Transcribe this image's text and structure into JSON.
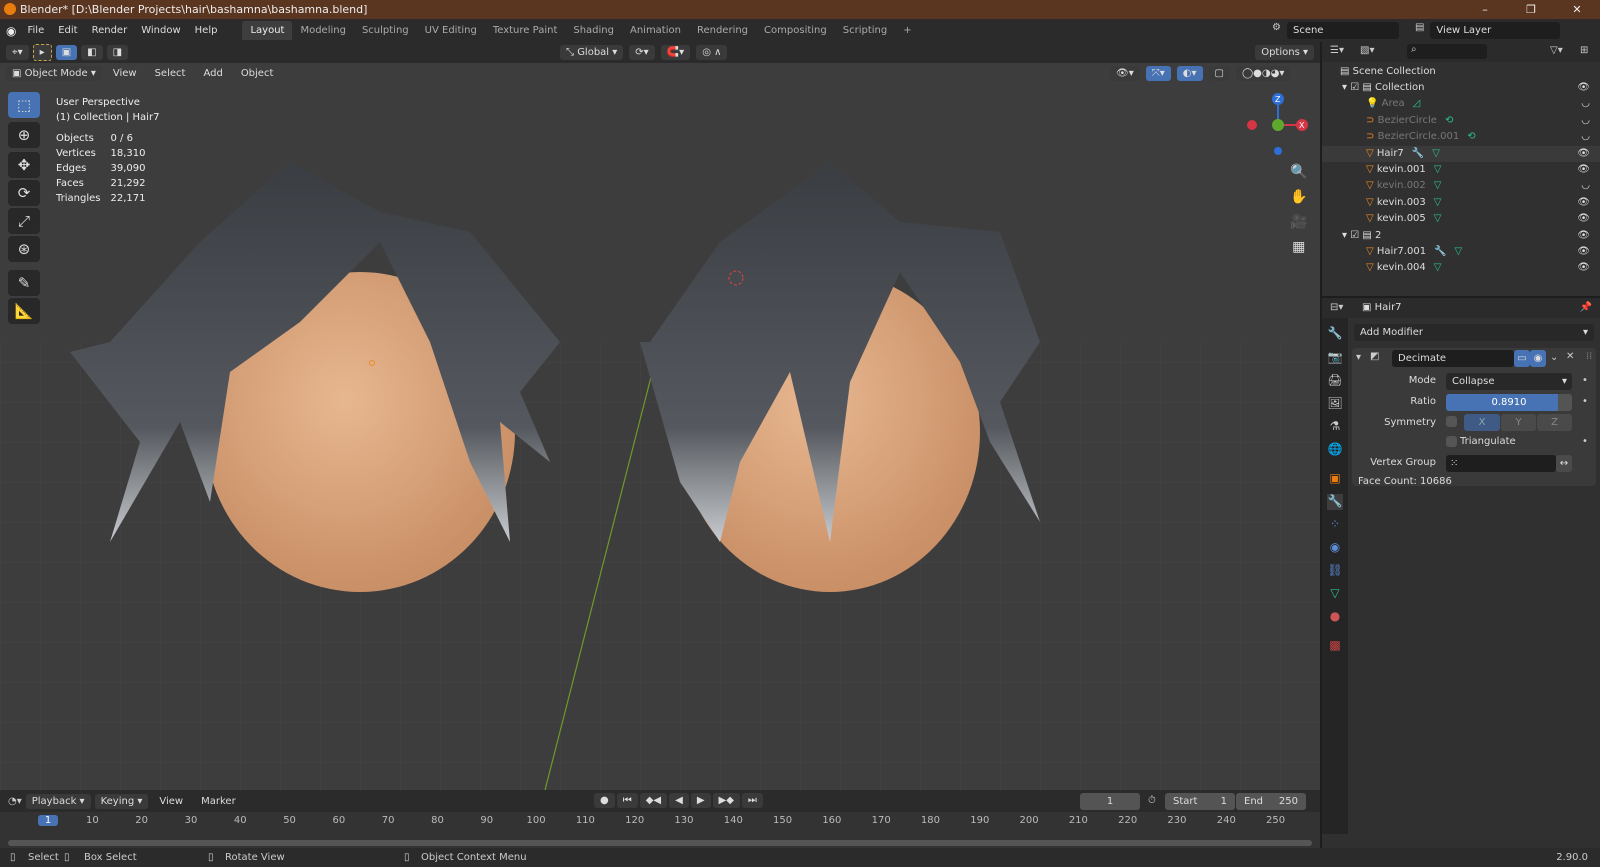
{
  "title": "Blender* [D:\\Blender Projects\\hair\\bashamna\\bashamna.blend]",
  "window_buttons": [
    "–",
    "❐",
    "✕"
  ],
  "menus": [
    "File",
    "Edit",
    "Render",
    "Window",
    "Help"
  ],
  "workspaces": [
    "Layout",
    "Modeling",
    "Sculpting",
    "UV Editing",
    "Texture Paint",
    "Shading",
    "Animation",
    "Rendering",
    "Compositing",
    "Scripting",
    "+"
  ],
  "scene": "Scene",
  "view_layer": "View Layer",
  "viewport": {
    "orientation": "Global",
    "options": "Options",
    "mode": "Object Mode",
    "menus": [
      "View",
      "Select",
      "Add",
      "Object"
    ],
    "perspective": "User Perspective",
    "collection": "(1) Collection | Hair7",
    "stats": [
      [
        "Objects",
        "0 / 6"
      ],
      [
        "Vertices",
        "18,310"
      ],
      [
        "Edges",
        "39,090"
      ],
      [
        "Faces",
        "21,292"
      ],
      [
        "Triangles",
        "22,171"
      ]
    ],
    "gizmo": {
      "x": "X",
      "z": "Z"
    }
  },
  "outliner": {
    "root": "Scene Collection",
    "items": [
      {
        "name": "Collection",
        "level": 0,
        "type": "collection",
        "dim": false
      },
      {
        "name": "Area",
        "level": 1,
        "type": "light",
        "dim": true
      },
      {
        "name": "BezierCircle",
        "level": 1,
        "type": "curve",
        "dim": true
      },
      {
        "name": "BezierCircle.001",
        "level": 1,
        "type": "curve",
        "dim": true
      },
      {
        "name": "Hair7",
        "level": 1,
        "type": "mesh",
        "dim": false,
        "modifier": true
      },
      {
        "name": "kevin.001",
        "level": 1,
        "type": "mesh",
        "dim": false
      },
      {
        "name": "kevin.002",
        "level": 1,
        "type": "mesh",
        "dim": true
      },
      {
        "name": "kevin.003",
        "level": 1,
        "type": "mesh",
        "dim": false
      },
      {
        "name": "kevin.005",
        "level": 1,
        "type": "mesh",
        "dim": false
      },
      {
        "name": "2",
        "level": 0,
        "type": "collection",
        "dim": false
      },
      {
        "name": "Hair7.001",
        "level": 1,
        "type": "mesh",
        "dim": false,
        "modifier": true
      },
      {
        "name": "kevin.004",
        "level": 1,
        "type": "mesh",
        "dim": false
      }
    ]
  },
  "properties": {
    "object": "Hair7",
    "add_modifier": "Add Modifier",
    "modifier": {
      "name": "Decimate",
      "mode_label": "Mode",
      "mode": "Collapse",
      "ratio_label": "Ratio",
      "ratio": "0.8910",
      "ratio_value": 0.891,
      "symmetry_label": "Symmetry",
      "axes": [
        "X",
        "Y",
        "Z"
      ],
      "triangulate": "Triangulate",
      "vgroup_label": "Vertex Group",
      "face_count": "Face Count: 10686"
    }
  },
  "timeline": {
    "menus": [
      "Playback",
      "Keying",
      "View",
      "Marker"
    ],
    "current_frame": "1",
    "start_label": "Start",
    "start": "1",
    "end_label": "End",
    "end": "250",
    "ticks": [
      "1",
      "10",
      "20",
      "30",
      "40",
      "50",
      "60",
      "70",
      "80",
      "90",
      "100",
      "110",
      "120",
      "130",
      "140",
      "150",
      "160",
      "170",
      "180",
      "190",
      "200",
      "210",
      "220",
      "230",
      "240",
      "250"
    ]
  },
  "status": {
    "select": "Select",
    "box_select": "Box Select",
    "rotate": "Rotate View",
    "context": "Object Context Menu",
    "version": "2.90.0"
  }
}
